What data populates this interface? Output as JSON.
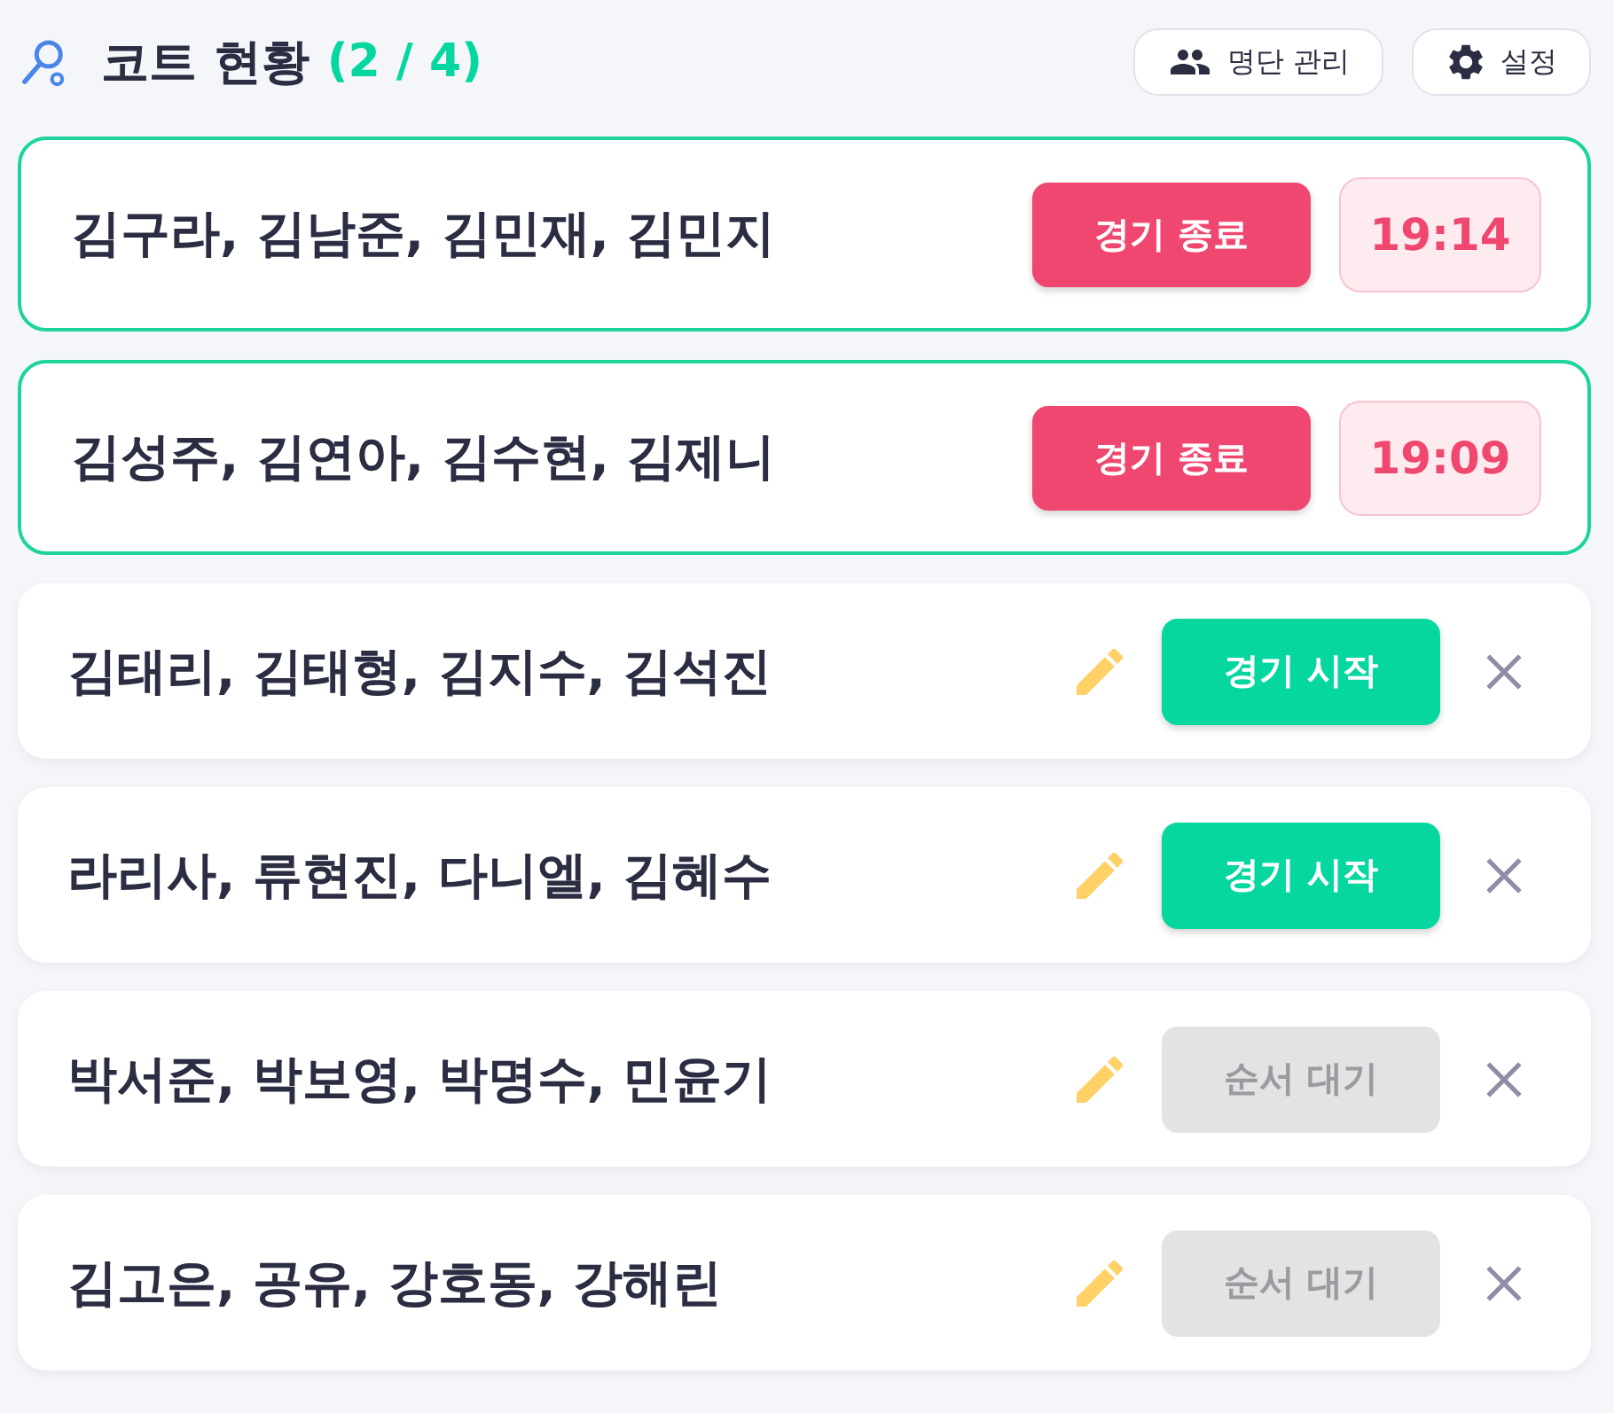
{
  "header": {
    "title": "코트 현황",
    "count": "(2 / 4)",
    "roster_button": {
      "label": "명단 관리"
    },
    "settings_button": {
      "label": "설정"
    }
  },
  "courts": [
    {
      "kind": "playing",
      "players": "김구라, 김남준, 김민재, 김민지",
      "action": "경기 종료",
      "time": "19:14"
    },
    {
      "kind": "playing",
      "players": "김성주, 김연아, 김수현, 김제니",
      "action": "경기 종료",
      "time": "19:09"
    },
    {
      "kind": "waiting",
      "players": "김태리, 김태형, 김지수, 김석진",
      "action": "경기 시작",
      "disabled": false
    },
    {
      "kind": "waiting",
      "players": "라리사, 류현진, 다니엘, 김혜수",
      "action": "경기 시작",
      "disabled": false
    },
    {
      "kind": "waiting",
      "players": "박서준, 박보영, 박명수, 민윤기",
      "action": "순서 대기",
      "disabled": true
    },
    {
      "kind": "waiting",
      "players": "김고은, 공유, 강호동, 강해린",
      "action": "순서 대기",
      "disabled": true
    }
  ]
}
